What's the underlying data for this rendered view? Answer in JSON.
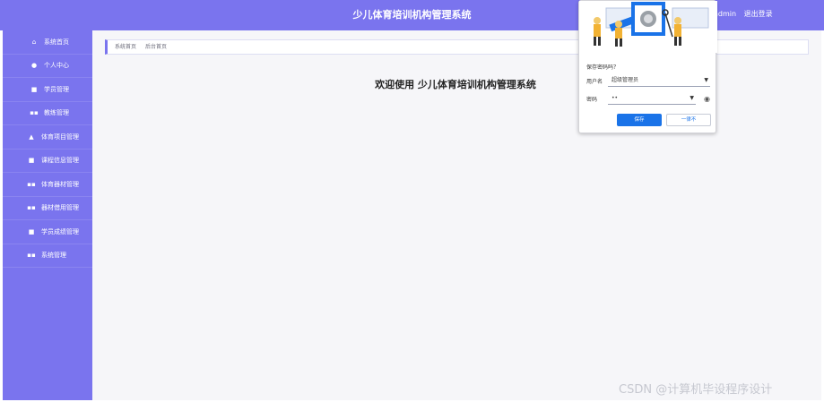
{
  "header": {
    "title": "少儿体育培训机构管理系统",
    "user": "admin",
    "logout": "退出登录"
  },
  "sidebar": {
    "items": [
      {
        "label": "系统首页",
        "icon": "home-icon",
        "glyph": "⌂"
      },
      {
        "label": "个人中心",
        "icon": "user-icon",
        "glyph": "●"
      },
      {
        "label": "学员管理",
        "icon": "shield-icon",
        "glyph": "■"
      },
      {
        "label": "教练管理",
        "icon": "grid-icon",
        "glyph": "▪▪"
      },
      {
        "label": "体育项目管理",
        "icon": "house-icon",
        "glyph": "▲"
      },
      {
        "label": "课程信息管理",
        "icon": "file-icon",
        "glyph": "■"
      },
      {
        "label": "体育器材管理",
        "icon": "grid-icon",
        "glyph": "▪▪"
      },
      {
        "label": "器材借用管理",
        "icon": "grid-icon",
        "glyph": "▪▪"
      },
      {
        "label": "学员成绩管理",
        "icon": "shield-icon",
        "glyph": "■"
      },
      {
        "label": "系统管理",
        "icon": "grid-icon",
        "glyph": "▪▪"
      }
    ]
  },
  "breadcrumb": [
    "系统首页",
    "后台首页"
  ],
  "main": {
    "welcome": "欢迎使用 少儿体育培训机构管理系统"
  },
  "popup": {
    "prompt": "保存密码吗？",
    "username_label": "用户名",
    "username_value": "超级管理员",
    "password_label": "密码",
    "password_value": "••",
    "save_button": "保存",
    "never_button": "一律不",
    "eye_icon": "eye-icon"
  },
  "watermark": "CSDN @计算机毕设程序设计",
  "colors": {
    "brand": "#7a74ee",
    "primary_button": "#1a73e8",
    "background": "#f6f6f9"
  }
}
